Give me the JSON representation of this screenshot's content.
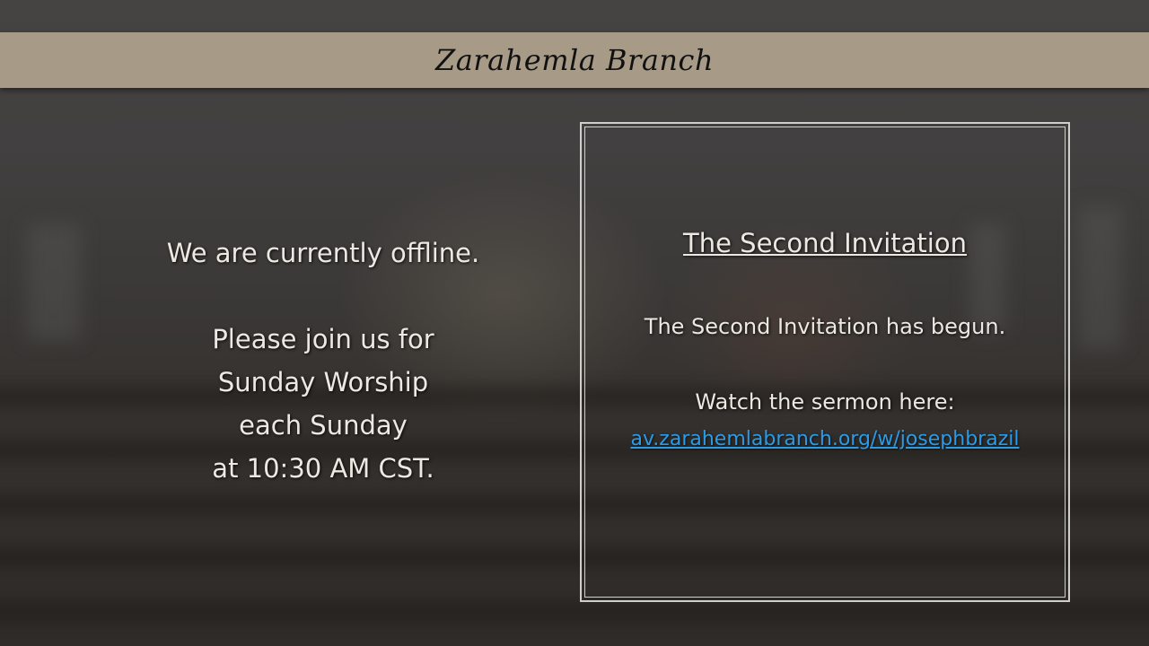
{
  "header": {
    "title": "Zarahemla Branch",
    "background_color": "#a79b88"
  },
  "offline_message": {
    "status": "We are currently offline.",
    "lines": [
      "Please join us for",
      "Sunday Worship",
      "each Sunday",
      "at 10:30 AM CST."
    ]
  },
  "invitation": {
    "title": "The Second Invitation",
    "announcement": "The Second Invitation has begun.",
    "watch_label": "Watch the sermon here:",
    "link_text": "av.zarahemlabranch.org/w/josephbrazil",
    "link_color": "#2a9be8"
  }
}
